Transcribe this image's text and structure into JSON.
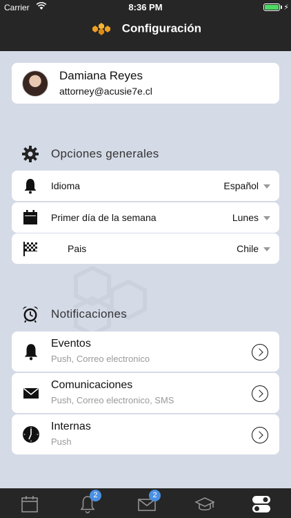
{
  "status": {
    "carrier": "Carrier",
    "time": "8:36 PM"
  },
  "nav": {
    "title": "Configuración"
  },
  "profile": {
    "name": "Damiana Reyes",
    "email": "attorney@acusie7e.cl"
  },
  "general": {
    "heading": "Opciones generales",
    "options": [
      {
        "label": "Idioma",
        "value": "Español",
        "icon": "bell-icon"
      },
      {
        "label": "Primer día de la semana",
        "value": "Lunes",
        "icon": "calendar-icon"
      },
      {
        "label": "Pais",
        "value": "Chile",
        "icon": "flag-icon"
      }
    ]
  },
  "notifications": {
    "heading": "Notificaciones",
    "items": [
      {
        "title": "Eventos",
        "subtitle": "Push, Correo electronico",
        "icon": "bell-icon"
      },
      {
        "title": "Comunicaciones",
        "subtitle": "Push, Correo electronico, SMS",
        "icon": "envelope-icon"
      },
      {
        "title": "Internas",
        "subtitle": "Push",
        "icon": "clock-icon"
      }
    ]
  },
  "tabbar": {
    "tabs": [
      {
        "icon": "calendar-icon"
      },
      {
        "icon": "bell-icon",
        "badge": "2"
      },
      {
        "icon": "envelope-icon",
        "badge": "2"
      },
      {
        "icon": "graduation-cap-icon"
      },
      {
        "icon": "settings-toggle-icon"
      }
    ]
  },
  "colors": {
    "bar": "#262626",
    "background": "#d4dae6",
    "badge": "#4a90e2",
    "battery": "#4cd964",
    "logo": "#f0a020"
  }
}
